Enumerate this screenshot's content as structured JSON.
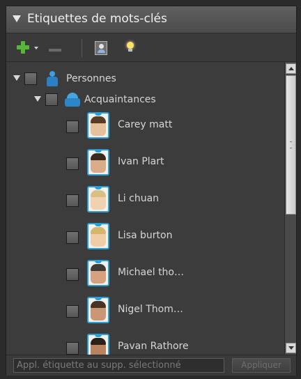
{
  "panel": {
    "title": "Etiquettes de mots-clés"
  },
  "toolbar": {
    "new_icon": "plus-icon",
    "menu_icon": "caret-down-icon",
    "delete_icon": "minus-icon",
    "person_icon": "person-card-icon",
    "bulb_icon": "lightbulb-icon"
  },
  "tree": {
    "category": {
      "label": "Personnes",
      "icon": "person-tag-icon",
      "subcategory": {
        "label": "Acquaintances",
        "icon": "group-icon"
      }
    },
    "people": [
      {
        "label": "Carey matt",
        "skin": "#e7c19c",
        "hair": "#5a3b26"
      },
      {
        "label": "Ivan Plart",
        "skin": "#d9ad8a",
        "hair": "#3a2a1d"
      },
      {
        "label": "Li chuan",
        "skin": "#f0d2b0",
        "hair": "#d8c082"
      },
      {
        "label": "Lisa burton",
        "skin": "#efcda6",
        "hair": "#d6b56c"
      },
      {
        "label": "Michael tho…",
        "skin": "#d5a27f",
        "hair": "#3e3a36"
      },
      {
        "label": "Nigel Thom…",
        "skin": "#c99775",
        "hair": "#4b3323"
      },
      {
        "label": "Pavan Rathore",
        "skin": "#b98360",
        "hair": "#2a1f19"
      }
    ]
  },
  "footer": {
    "input_placeholder": "Appl. étiquette au supp. sélectionné",
    "apply_label": "Appliquer"
  },
  "colors": {
    "panel_bg": "#3c3c3c",
    "accent_blue": "#29a0d8",
    "add_green": "#57b53a"
  }
}
